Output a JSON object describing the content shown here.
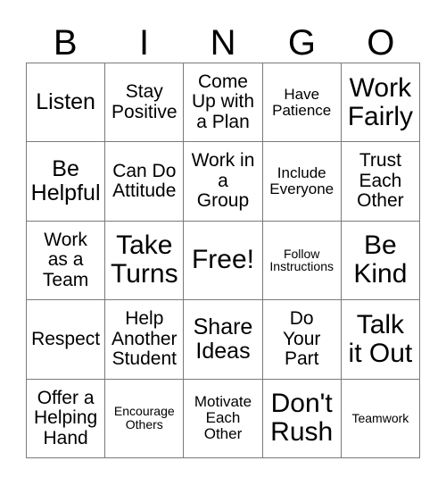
{
  "card": {
    "title_letters": [
      "B",
      "I",
      "N",
      "G",
      "O"
    ],
    "columns": 5,
    "rows": 5,
    "border_color": "#7a7a7a",
    "text_color": "#000000",
    "background_color": "#ffffff",
    "cells": [
      {
        "text": "Listen",
        "size": "lg"
      },
      {
        "text": "Stay\nPositive",
        "size": "md"
      },
      {
        "text": "Come\nUp with\na Plan",
        "size": "md"
      },
      {
        "text": "Have\nPatience",
        "size": "sm"
      },
      {
        "text": "Work\nFairly",
        "size": "xl"
      },
      {
        "text": "Be\nHelpful",
        "size": "lg"
      },
      {
        "text": "Can Do\nAttitude",
        "size": "md"
      },
      {
        "text": "Work in\na\nGroup",
        "size": "md"
      },
      {
        "text": "Include\nEveryone",
        "size": "sm"
      },
      {
        "text": "Trust\nEach\nOther",
        "size": "md"
      },
      {
        "text": "Work\nas a\nTeam",
        "size": "md"
      },
      {
        "text": "Take\nTurns",
        "size": "xl"
      },
      {
        "text": "Free!",
        "size": "xl"
      },
      {
        "text": "Follow\nInstructions",
        "size": "xs"
      },
      {
        "text": "Be\nKind",
        "size": "xl"
      },
      {
        "text": "Respect",
        "size": "md"
      },
      {
        "text": "Help\nAnother\nStudent",
        "size": "md"
      },
      {
        "text": "Share\nIdeas",
        "size": "lg"
      },
      {
        "text": "Do\nYour\nPart",
        "size": "md"
      },
      {
        "text": "Talk\nit Out",
        "size": "xl"
      },
      {
        "text": "Offer a\nHelping\nHand",
        "size": "md"
      },
      {
        "text": "Encourage\nOthers",
        "size": "xs"
      },
      {
        "text": "Motivate\nEach\nOther",
        "size": "sm"
      },
      {
        "text": "Don't\nRush",
        "size": "xl"
      },
      {
        "text": "Teamwork",
        "size": "xs"
      }
    ]
  }
}
